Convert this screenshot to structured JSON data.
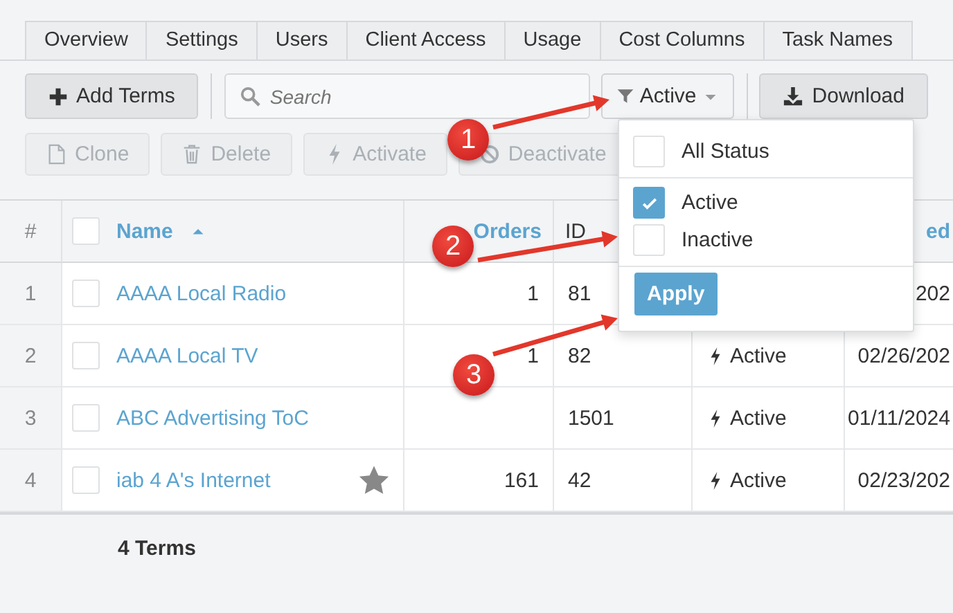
{
  "tabs": [
    {
      "label": "Overview"
    },
    {
      "label": "Settings"
    },
    {
      "label": "Users"
    },
    {
      "label": "Client Access"
    },
    {
      "label": "Usage"
    },
    {
      "label": "Cost Columns"
    },
    {
      "label": "Task Names"
    }
  ],
  "toolbar": {
    "add_button": "Add Terms",
    "search": {
      "placeholder": "Search"
    },
    "filter_button": "Active",
    "download_button": "Download"
  },
  "actions": [
    {
      "label": "Clone",
      "disabled": true
    },
    {
      "label": "Delete",
      "disabled": true
    },
    {
      "label": "Activate",
      "disabled": true
    },
    {
      "label": "Deactivate",
      "disabled": true
    }
  ],
  "table": {
    "select_all": {
      "checked": false
    },
    "columns": [
      {
        "label": "#",
        "kind": "number"
      },
      {
        "label": "Name",
        "kind": "name"
      },
      {
        "label": "Orders",
        "kind": "count"
      },
      {
        "label": "ID",
        "kind": "text"
      },
      {
        "kind": "status"
      },
      {
        "label": "ed",
        "kind": "date"
      }
    ],
    "rows": [
      {
        "number": "1",
        "checked": false,
        "name": "AAAA Local Radio",
        "starred": false,
        "orders": "1",
        "id": "81",
        "date": "202"
      },
      {
        "number": "2",
        "checked": false,
        "name": "AAAA Local TV",
        "starred": false,
        "orders": "1",
        "id": "82",
        "status": "Active",
        "date": "02/26/202"
      },
      {
        "number": "3",
        "checked": false,
        "name": "ABC Advertising ToC",
        "starred": false,
        "id": "1501",
        "status": "Active",
        "date": "01/11/2024"
      },
      {
        "number": "4",
        "checked": false,
        "name": "iab 4 A's Internet",
        "starred": true,
        "orders": "161",
        "id": "42",
        "status": "Active",
        "date": "02/23/202"
      }
    ],
    "footer": "4 Terms"
  },
  "status_dropdown": {
    "options": [
      {
        "label": "All Status",
        "checked": false
      },
      {
        "label": "Active",
        "checked": true
      },
      {
        "label": "Inactive",
        "checked": false
      }
    ],
    "apply_button": "Apply"
  },
  "annotations": [
    {
      "number": "1"
    },
    {
      "number": "2"
    },
    {
      "number": "3"
    }
  ]
}
